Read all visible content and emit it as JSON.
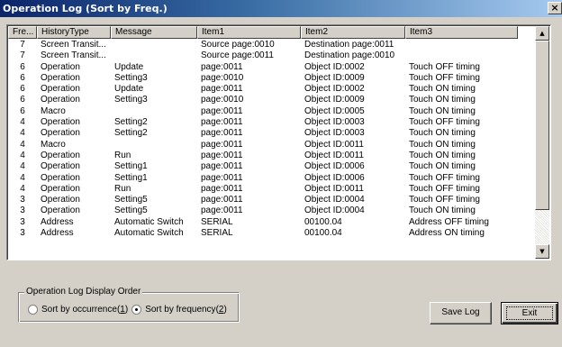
{
  "window": {
    "title": "Operation Log (Sort by Freq.)",
    "close_glyph": "×"
  },
  "columns": [
    "Fre...",
    "HistoryType",
    "Message",
    "Item1",
    "Item2",
    "Item3"
  ],
  "rows": [
    [
      "7",
      "Screen Transit...",
      "",
      "Source page:0010",
      "Destination page:0011",
      ""
    ],
    [
      "7",
      "Screen Transit...",
      "",
      "Source page:0011",
      "Destination page:0010",
      ""
    ],
    [
      "6",
      "Operation",
      "Update",
      "page:0011",
      "Object ID:0002",
      "Touch OFF timing"
    ],
    [
      "6",
      "Operation",
      "Setting3",
      "page:0010",
      "Object ID:0009",
      "Touch OFF timing"
    ],
    [
      "6",
      "Operation",
      "Update",
      "page:0011",
      "Object ID:0002",
      "Touch ON timing"
    ],
    [
      "6",
      "Operation",
      "Setting3",
      "page:0010",
      "Object ID:0009",
      "Touch ON timing"
    ],
    [
      "6",
      "Macro",
      "",
      "page:0011",
      "Object ID:0005",
      "Touch ON timing"
    ],
    [
      "4",
      "Operation",
      "Setting2",
      "page:0011",
      "Object ID:0003",
      "Touch OFF timing"
    ],
    [
      "4",
      "Operation",
      "Setting2",
      "page:0011",
      "Object ID:0003",
      "Touch ON timing"
    ],
    [
      "4",
      "Macro",
      "",
      "page:0011",
      "Object ID:0011",
      "Touch ON timing"
    ],
    [
      "4",
      "Operation",
      "Run",
      "page:0011",
      "Object ID:0011",
      "Touch ON timing"
    ],
    [
      "4",
      "Operation",
      "Setting1",
      "page:0011",
      "Object ID:0006",
      "Touch ON timing"
    ],
    [
      "4",
      "Operation",
      "Setting1",
      "page:0011",
      "Object ID:0006",
      "Touch OFF timing"
    ],
    [
      "4",
      "Operation",
      "Run",
      "page:0011",
      "Object ID:0011",
      "Touch OFF timing"
    ],
    [
      "3",
      "Operation",
      "Setting5",
      "page:0011",
      "Object ID:0004",
      "Touch OFF timing"
    ],
    [
      "3",
      "Operation",
      "Setting5",
      "page:0011",
      "Object ID:0004",
      "Touch ON timing"
    ],
    [
      "3",
      "Address",
      "Automatic Switch",
      "SERIAL",
      "00100.04",
      "Address OFF timing"
    ],
    [
      "3",
      "Address",
      "Automatic Switch",
      "SERIAL",
      "00100.04",
      "Address ON timing"
    ]
  ],
  "scrollbar": {
    "up_glyph": "▲",
    "down_glyph": "▼"
  },
  "display_order": {
    "title": "Operation Log Display Order",
    "occurrence_label": "Sort by occurrence",
    "occurrence_key": "1",
    "frequency_label": "Sort by frequency",
    "frequency_key": "2",
    "selected": "frequency"
  },
  "buttons": {
    "save_log": "Save Log",
    "exit": "Exit"
  }
}
